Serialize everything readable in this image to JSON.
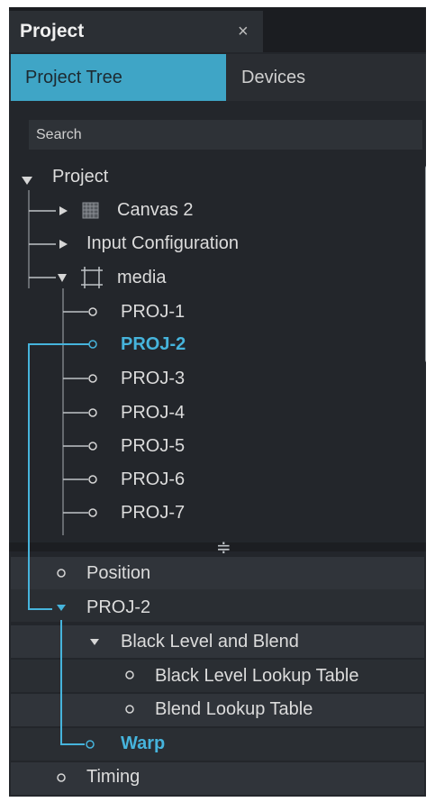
{
  "panel": {
    "title": "Project",
    "close_glyph": "×"
  },
  "tabs": [
    {
      "label": "Project Tree",
      "active": true
    },
    {
      "label": "Devices",
      "active": false
    }
  ],
  "search": {
    "placeholder": "Search"
  },
  "tree": {
    "root": "Project",
    "children": [
      "Canvas 2",
      "Input Configuration",
      "media"
    ],
    "media_items": [
      "PROJ-1",
      "PROJ-2",
      "PROJ-3",
      "PROJ-4",
      "PROJ-5",
      "PROJ-6",
      "PROJ-7"
    ],
    "selected": "PROJ-2"
  },
  "details": {
    "position": "Position",
    "proj": "PROJ-2",
    "black_level_blend": "Black Level and Blend",
    "black_level_lut": "Black Level Lookup Table",
    "blend_lut": "Blend Lookup Table",
    "warp": "Warp",
    "timing": "Timing"
  },
  "colors": {
    "accent": "#46b4dc",
    "panel_bg": "#23262b",
    "tab_active": "#3fa5c6"
  }
}
